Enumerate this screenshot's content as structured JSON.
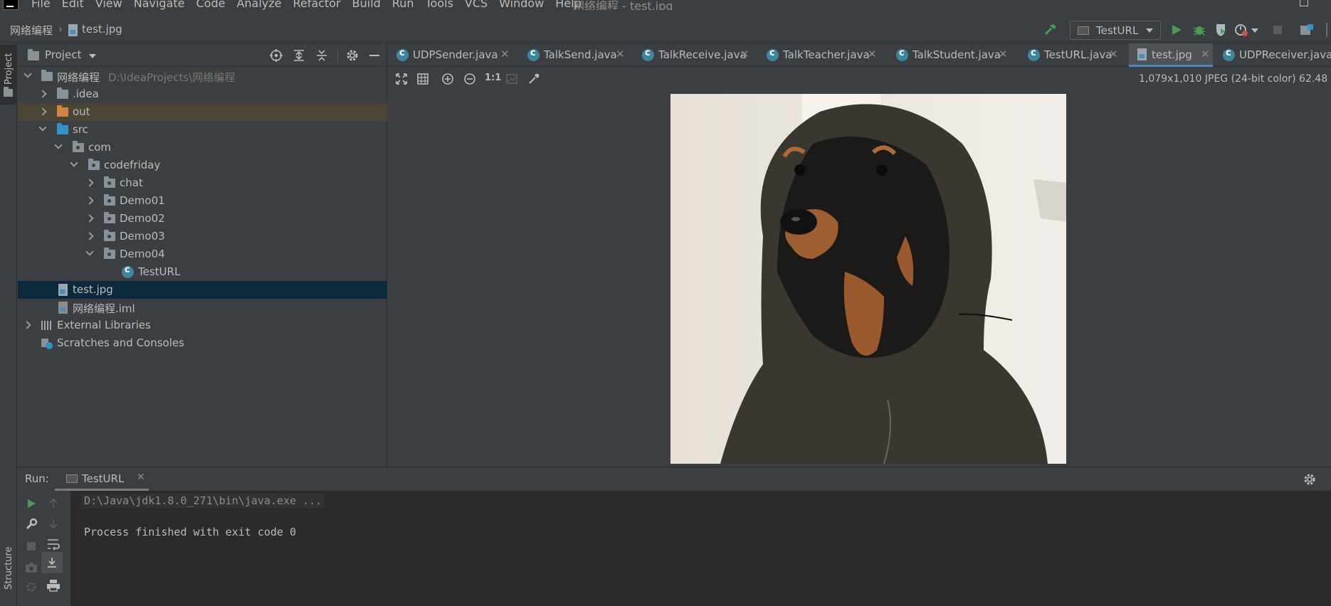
{
  "menubar": {
    "items": [
      "File",
      "Edit",
      "View",
      "Navigate",
      "Code",
      "Analyze",
      "Refactor",
      "Build",
      "Run",
      "Tools",
      "VCS",
      "Window",
      "Help"
    ],
    "window_title": "网络编程 - test.jpg"
  },
  "navbar": {
    "breadcrumb_project": "网络编程",
    "breadcrumb_file": "test.jpg",
    "run_config": "TestURL"
  },
  "left_stripe": {
    "project": "Project",
    "structure": "Structure"
  },
  "project_panel": {
    "title": "Project",
    "root_name": "网络编程",
    "root_path": "D:\\IdeaProjects\\网络编程",
    "items": {
      "idea": ".idea",
      "out": "out",
      "src": "src",
      "com": "com",
      "codefriday": "codefriday",
      "chat": "chat",
      "demo01": "Demo01",
      "demo02": "Demo02",
      "demo03": "Demo03",
      "demo04": "Demo04",
      "testurl": "TestURL",
      "test_jpg": "test.jpg",
      "iml": "网络编程.iml",
      "external_libraries": "External Libraries",
      "scratches": "Scratches and Consoles"
    }
  },
  "editor_tabs": [
    {
      "label": "UDPSender.java"
    },
    {
      "label": "TalkSend.java"
    },
    {
      "label": "TalkReceive.java"
    },
    {
      "label": "TalkTeacher.java"
    },
    {
      "label": "TalkStudent.java"
    },
    {
      "label": "TestURL.java"
    },
    {
      "label": "test.jpg"
    },
    {
      "label": "UDPReceiver.java"
    }
  ],
  "viewer": {
    "zoom_actual": "1:1",
    "image_info": "1,079x1,010 JPEG (24-bit color) 62.48"
  },
  "run_panel": {
    "label": "Run:",
    "tab": "TestURL",
    "command": "D:\\Java\\jdk1.8.0_271\\bin\\java.exe ...",
    "result": "Process finished with exit code 0"
  },
  "colors": {
    "background": "#3c3f41",
    "console_bg": "#2b2b2b",
    "selection": "#0d293e",
    "active_tab_underline": "#4a88c7",
    "run_green": "#499c54"
  }
}
